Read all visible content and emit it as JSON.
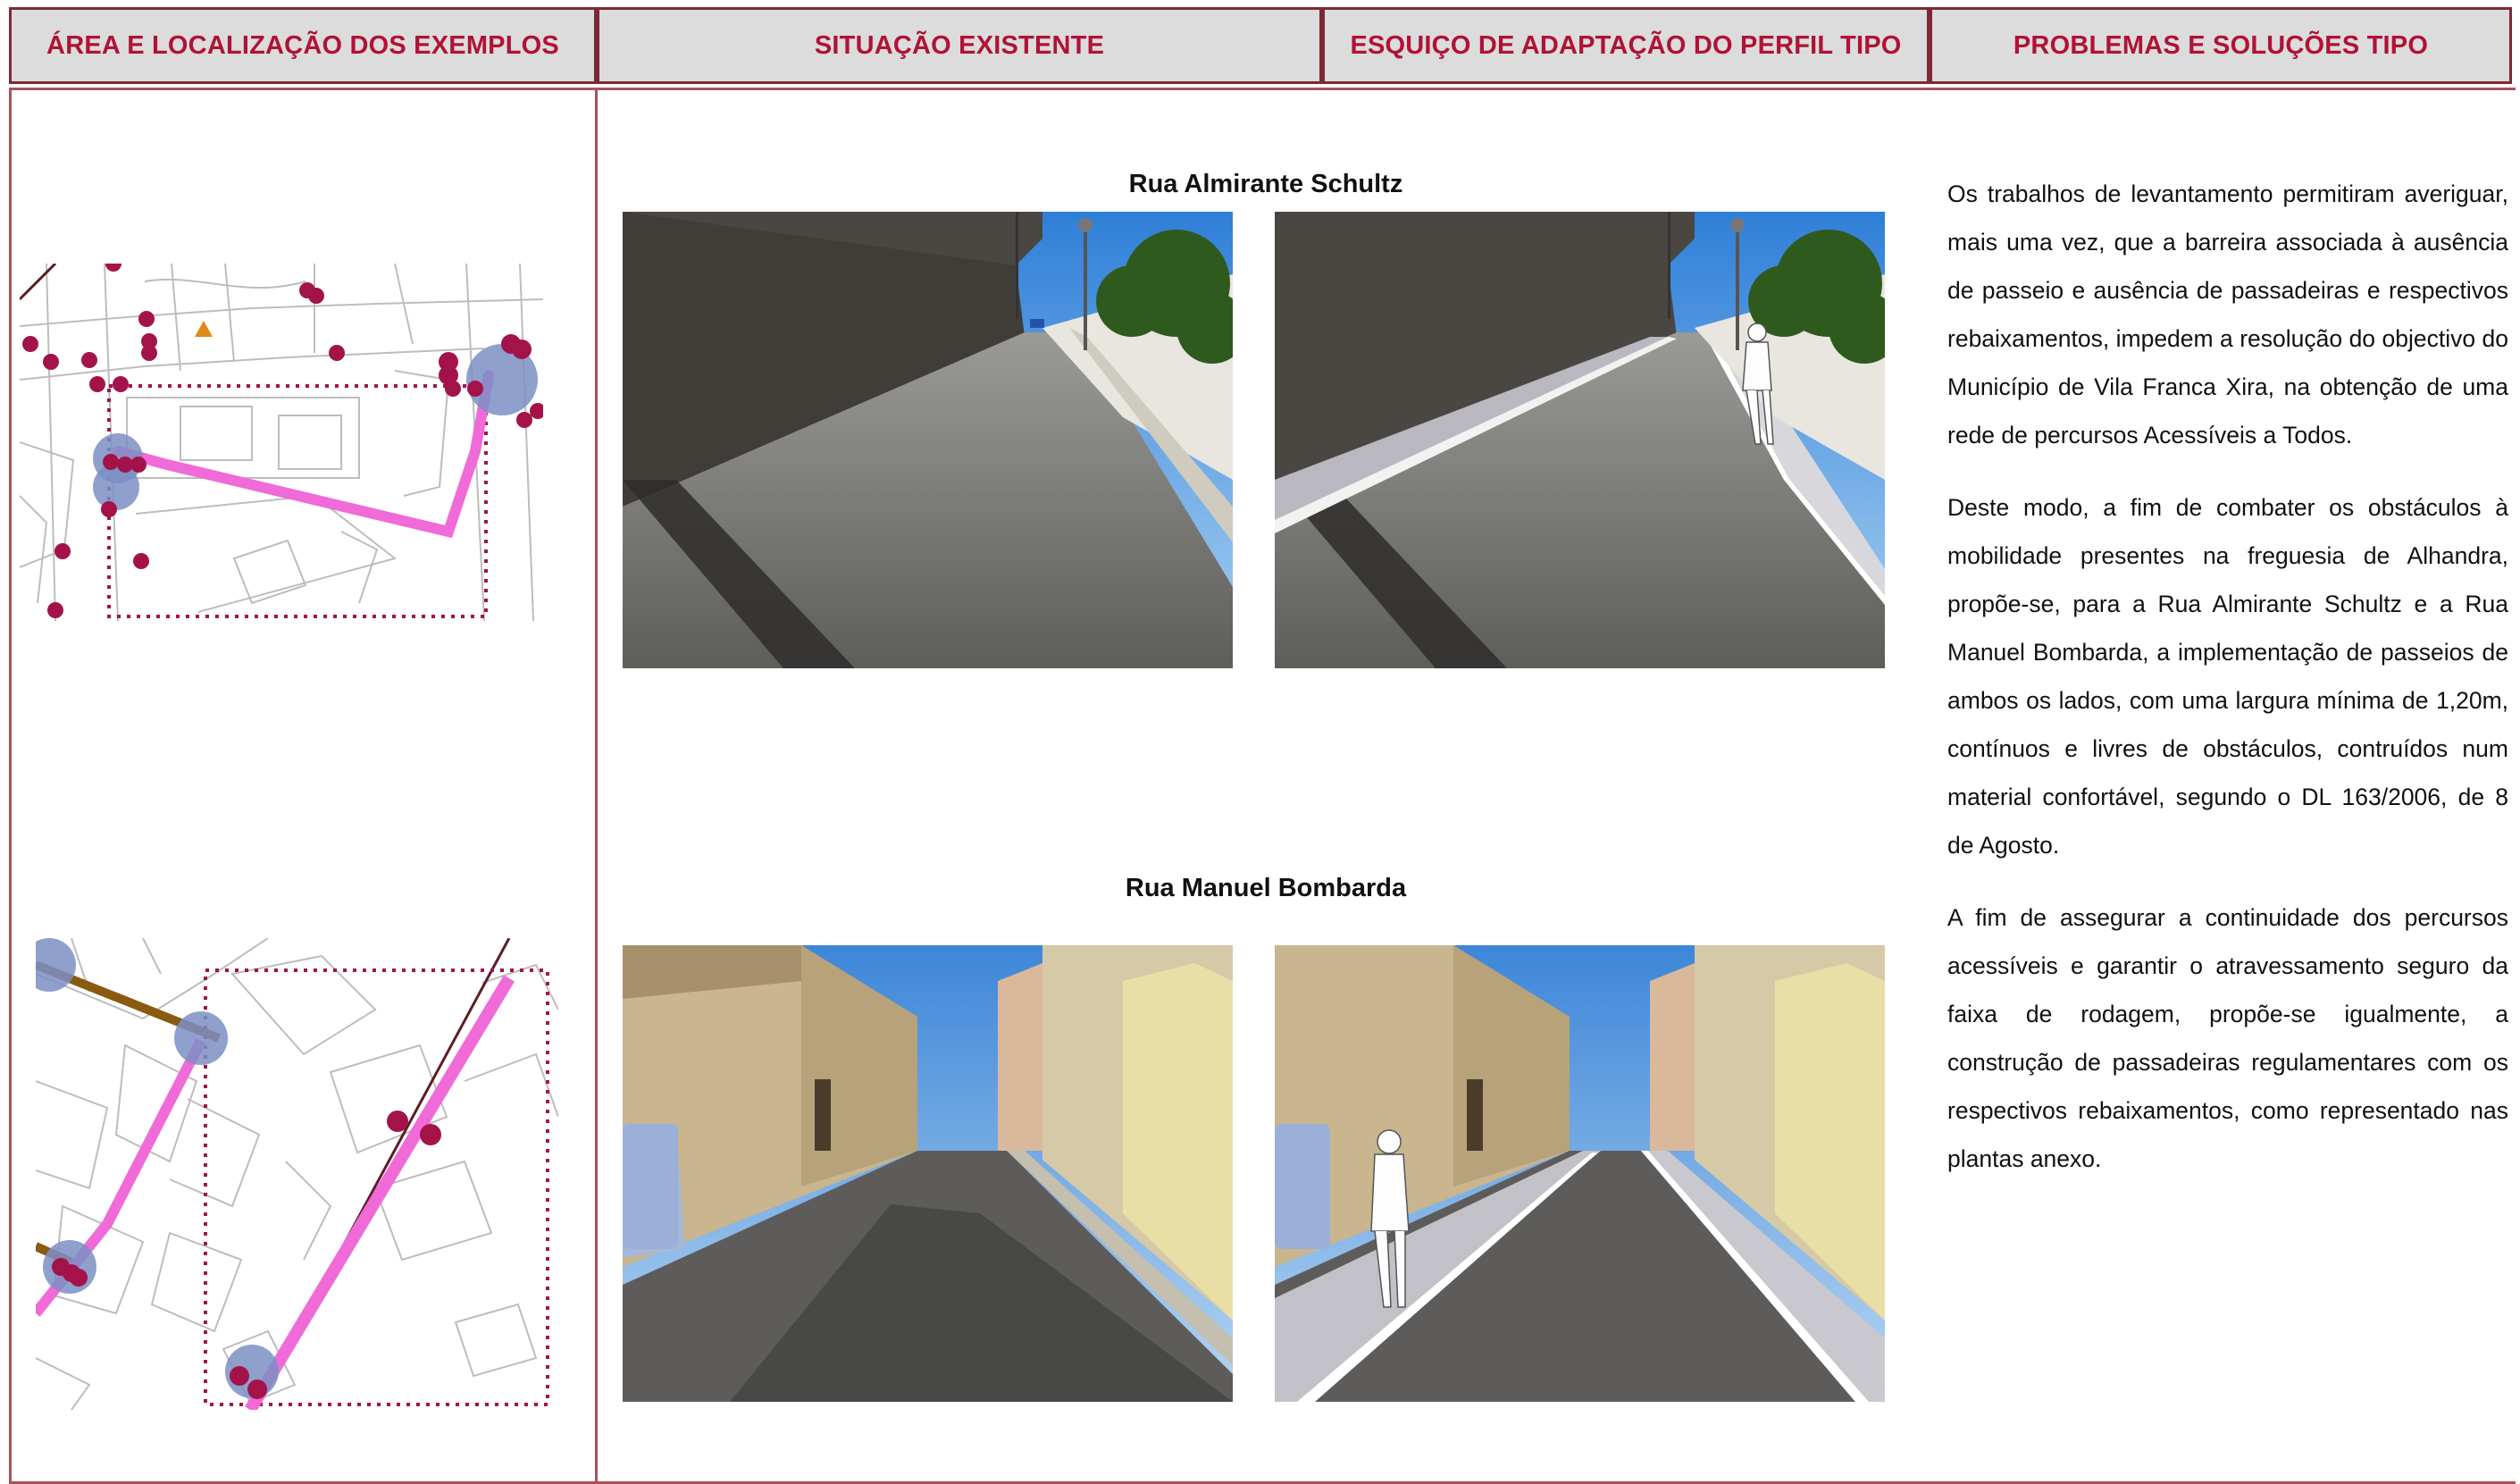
{
  "headers": {
    "area": "ÁREA E LOCALIZAÇÃO DOS EXEMPLOS",
    "situacao": "SITUAÇÃO EXISTENTE",
    "esquico": "ESQUIÇO DE ADAPTAÇÃO DO PERFIL TIPO",
    "problemas": "PROBLEMAS E SOLUÇÕES TIPO"
  },
  "streets": [
    {
      "name": "Rua Almirante Schultz"
    },
    {
      "name": "Rua Manuel Bombarda"
    }
  ],
  "paragraphs": [
    "Os trabalhos de levantamento permitiram averiguar, mais uma vez, que a barreira associada à ausência de passeio e ausência de passadeiras e respectivos rebaixamentos, impedem a resolução do objectivo do Município de Vila Franca Xira, na obtenção de uma rede de percursos Acessíveis a Todos.",
    "Deste modo, a fim de combater os obstáculos à mobilidade presentes na freguesia de Alhandra, propõe-se, para a Rua Almirante Schultz e a Rua Manuel Bombarda, a implementação de passeios de ambos os lados, com uma largura mínima de 1,20m, contínuos e livres de obstáculos, contruídos num material confortável, segundo o DL 163/2006, de 8 de Agosto.",
    "A fim de assegurar a continuidade dos percursos acessíveis e garantir o atravessamento seguro da faixa de rodagem, propõe-se igualmente, a construção de passadeiras regulamentares com os respectivos rebaixamentos, como representado nas plantas anexo."
  ],
  "colors": {
    "header_text": "#b01236",
    "header_bg": "#dcdcdc",
    "border": "#7b2a35",
    "route": "#f06ad8",
    "point": "#a3134a",
    "node": "#7b8fc4"
  }
}
